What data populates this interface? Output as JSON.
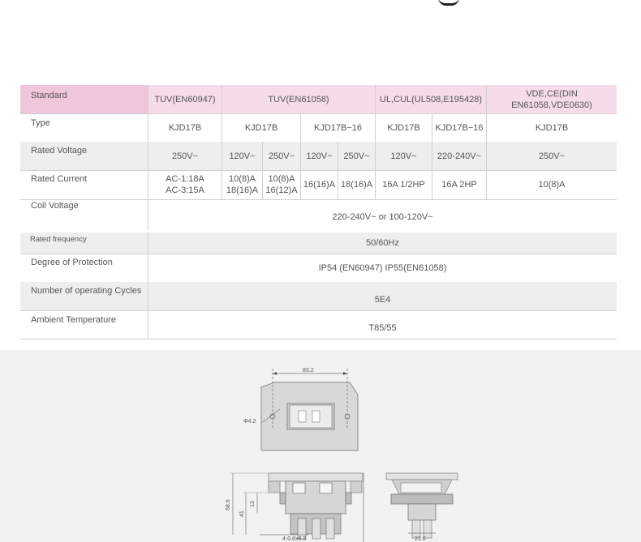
{
  "table": {
    "row_standard": {
      "label": "Standard",
      "c1": "TUV(EN60947)",
      "c2": "TUV(EN61058)",
      "c3": "UL,CUL(UL508,E195428)",
      "c4": "VDE,CE(DIN EN61058,VDE0630)"
    },
    "row_type": {
      "label": "Type",
      "c1": "KJD17B",
      "c2": "KJD17B",
      "c3": "KJD17B−16",
      "c4": "KJD17B",
      "c5": "KJD17B−16",
      "c6": "KJD17B"
    },
    "row_voltage": {
      "label": "Rated  Voltage",
      "c1": "250V~",
      "c2": "120V~",
      "c3": "250V~",
      "c4": "120V~",
      "c5": "250V~",
      "c6": "120V~",
      "c7": "220-240V~",
      "c8": "250V~"
    },
    "row_current": {
      "label": "Rated  Current",
      "c1a": "AC-1:18A",
      "c1b": "AC-3:15A",
      "c2a": "10(8)A",
      "c2b": "18(16)A",
      "c3a": "10(8)A",
      "c3b": "16(12)A",
      "c4": "16(16)A",
      "c5": "18(16)A",
      "c6": "16A  1/2HP",
      "c7": "16A  2HP",
      "c8": "10(8)A"
    },
    "row_coil": {
      "label": "Coil  Voltage",
      "value": "220-240V~ or 100-120V~"
    },
    "row_frequency": {
      "label": "Rated frequency",
      "value": "50/60Hz"
    },
    "row_protection": {
      "label": "Degree  of  Protection",
      "value": "IP54 (EN60947)   IP55(EN61058)"
    },
    "row_cycles": {
      "label": "Number  of  operating  Cycles",
      "value": "5E4"
    },
    "row_ambient": {
      "label": "Ambient  Temperature",
      "value": "T85/55"
    }
  },
  "drawing": {
    "top_width": "83.2",
    "hole_dia": "Φ4.2",
    "height_total": "68.6",
    "height_mid": "41",
    "height_small": "13",
    "hole_spec": "4-0.8x6.3",
    "side_width": "21.6"
  },
  "colors": {
    "header_pink": "#f0c6dc",
    "header_pink_light": "#f6dbe9",
    "alt_row": "#eeeeee",
    "border": "#cfcfcf"
  }
}
